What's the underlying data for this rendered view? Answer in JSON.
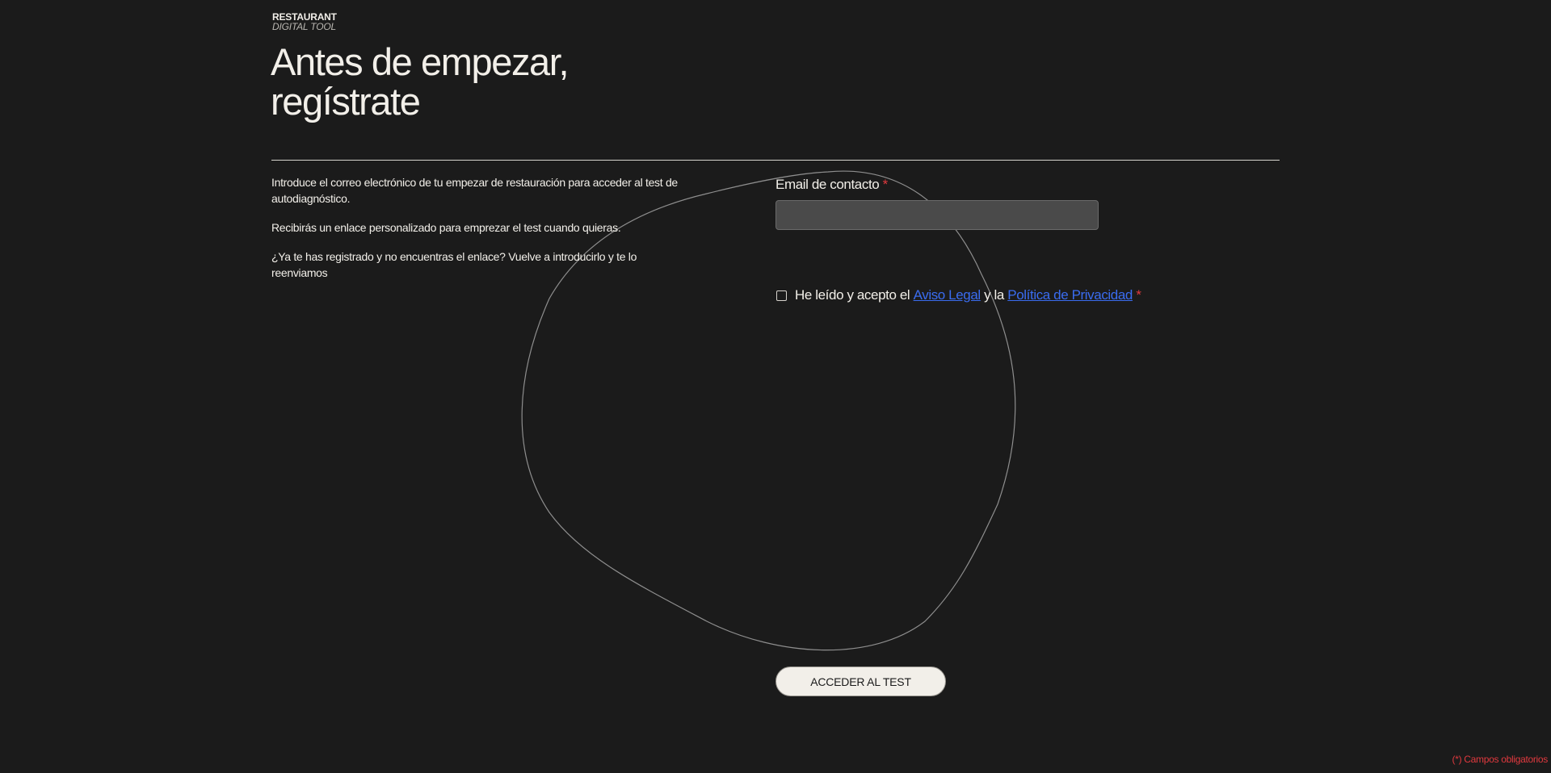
{
  "logo": {
    "line1": "RESTAURANT",
    "line2": "DIGITAL TOOL"
  },
  "title": {
    "line1": "Antes de empezar,",
    "line2": "regístrate"
  },
  "intro": {
    "p1": "Introduce el correo electrónico de tu empezar de restauración para acceder al test de autodiagnóstico.",
    "p2": "Recibirás un enlace personalizado para emprezar el test cuando quieras.",
    "p3": "¿Ya te has registrado y no encuentras el enlace? Vuelve a introducirlo y te lo reenviamos"
  },
  "form": {
    "email_label": "Email de contacto",
    "required_mark": "*",
    "email_value": "",
    "email_placeholder": "",
    "consent": {
      "checked": false,
      "prefix": "He leído y acepto el",
      "legal_link": "Aviso Legal",
      "joiner": "y la",
      "privacy_link": "Política de Privacidad",
      "required_mark": "*"
    },
    "submit_label": "ACCEDER AL TEST"
  },
  "footnote": "(*) Campos obligatorios",
  "colors": {
    "background": "#1b1b1b",
    "text": "#f2efe9",
    "required": "#e0393e",
    "link": "#3a6cf0",
    "input_bg": "#4a4a4a"
  }
}
